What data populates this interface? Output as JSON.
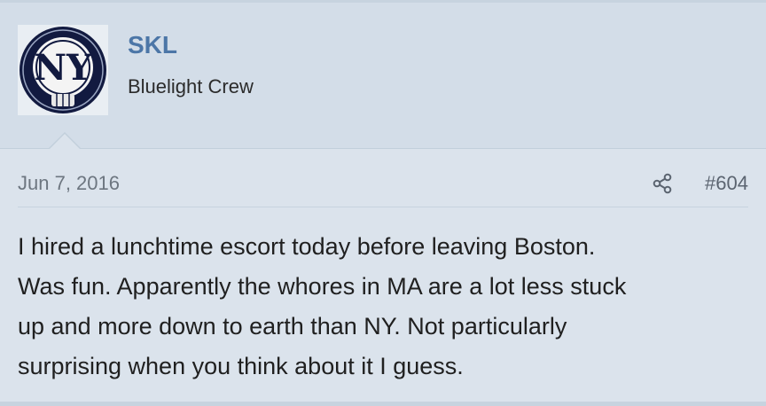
{
  "user": {
    "name": "SKL",
    "title": "Bluelight Crew",
    "avatar_icon": "yankees-skull-avatar-icon"
  },
  "post": {
    "date": "Jun 7, 2016",
    "number": "#604",
    "share_icon": "share-icon",
    "lines": [
      "I hired a lunchtime escort today before leaving Boston.",
      "Was fun. Apparently the whores in MA are a lot less stuck",
      "up and more down to earth than NY. Not particularly",
      "surprising when you think about it I guess."
    ]
  },
  "colors": {
    "username": "#4c76a7",
    "background": "#dbe3ec",
    "user_block": "#d3dde8"
  }
}
